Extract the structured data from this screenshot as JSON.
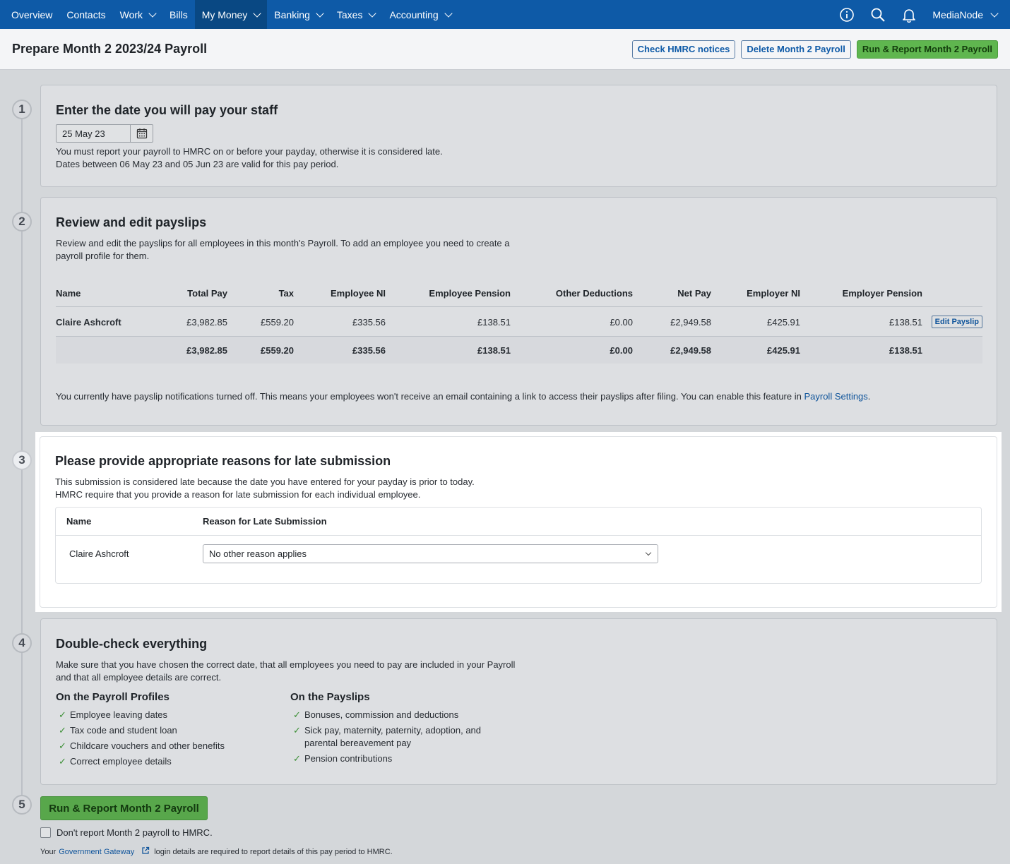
{
  "nav": {
    "items": [
      {
        "label": "Overview",
        "dropdown": false,
        "active": false
      },
      {
        "label": "Contacts",
        "dropdown": false,
        "active": false
      },
      {
        "label": "Work",
        "dropdown": true,
        "active": false
      },
      {
        "label": "Bills",
        "dropdown": false,
        "active": false
      },
      {
        "label": "My Money",
        "dropdown": true,
        "active": true
      },
      {
        "label": "Banking",
        "dropdown": true,
        "active": false
      },
      {
        "label": "Taxes",
        "dropdown": true,
        "active": false
      },
      {
        "label": "Accounting",
        "dropdown": true,
        "active": false
      }
    ],
    "account": "MediaNode"
  },
  "header": {
    "title": "Prepare Month 2 2023/24 Payroll",
    "check_notices": "Check HMRC notices",
    "delete": "Delete Month 2 Payroll",
    "run_report": "Run & Report Month 2 Payroll"
  },
  "steps": {
    "s1": {
      "num": "1",
      "title": "Enter the date you will pay your staff",
      "date": "25 May 23",
      "line1": "You must report your payroll to HMRC on or before your payday, otherwise it is considered late.",
      "line2": "Dates between 06 May 23 and 05 Jun 23 are valid for this pay period."
    },
    "s2": {
      "num": "2",
      "title": "Review and edit payslips",
      "desc1": "Review and edit the payslips for all employees in this month's Payroll. To add an employee you need to create a",
      "desc2": "payroll profile for them.",
      "columns": [
        "Name",
        "Total Pay",
        "Tax",
        "Employee NI",
        "Employee Pension",
        "Other Deductions",
        "Net Pay",
        "Employer NI",
        "Employer Pension"
      ],
      "row": [
        "Claire Ashcroft",
        "£3,982.85",
        "£559.20",
        "£335.56",
        "£138.51",
        "£0.00",
        "£2,949.58",
        "£425.91",
        "£138.51"
      ],
      "edit_label": "Edit Payslip",
      "totals": [
        "",
        "£3,982.85",
        "£559.20",
        "£335.56",
        "£138.51",
        "£0.00",
        "£2,949.58",
        "£425.91",
        "£138.51"
      ],
      "notice": "You currently have payslip notifications turned off. This means your employees won't receive an email containing a link to access their payslips after filing. You can enable this feature in ",
      "notice_link": "Payroll Settings",
      "notice_end": "."
    },
    "s3": {
      "num": "3",
      "title": "Please provide appropriate reasons for late submission",
      "line1": "This submission is considered late because the date you have entered for your payday is prior to today.",
      "line2": "HMRC require that you provide a reason for late submission for each individual employee.",
      "col_name": "Name",
      "col_reason": "Reason for Late Submission",
      "employee": "Claire Ashcroft",
      "reason": "No other reason applies"
    },
    "s4": {
      "num": "4",
      "title": "Double-check everything",
      "desc1": "Make sure that you have chosen the correct date, that all employees you need to pay are included in your Payroll",
      "desc2": "and that all employee details are correct.",
      "profiles_title": "On the Payroll Profiles",
      "profiles": [
        "Employee leaving dates",
        "Tax code and student loan",
        "Childcare vouchers and other benefits",
        "Correct employee details"
      ],
      "payslips_title": "On the Payslips",
      "payslips": [
        "Bonuses, commission and deductions",
        "Sick pay, maternity, paternity, adoption, and parental bereavement pay",
        "Pension contributions"
      ]
    },
    "s5": {
      "num": "5",
      "run": "Run & Report Month 2 Payroll",
      "dont_report": "Don't report Month 2 payroll to HMRC.",
      "gg_prefix": "Your",
      "gg_link": "Government Gateway",
      "gg_suffix": "login details are required to report details of this pay period to HMRC."
    }
  },
  "colors": {
    "nav": "#0e5aa7",
    "green": "#5fb64f",
    "link": "#0e5aa7"
  }
}
